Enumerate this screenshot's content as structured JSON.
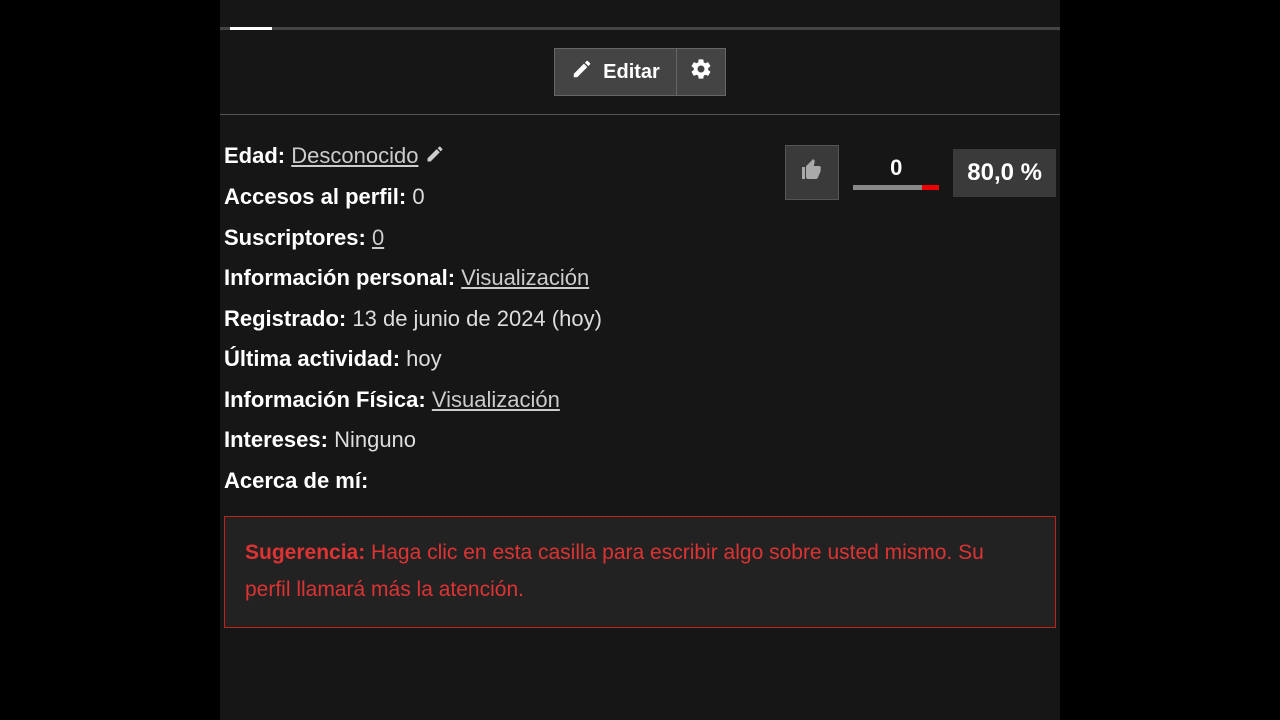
{
  "toolbar": {
    "edit_label": "Editar"
  },
  "info": {
    "age_label": "Edad:",
    "age_value": "Desconocido",
    "views_label": "Accesos al perfil:",
    "views_value": "0",
    "subscribers_label": "Suscriptores:",
    "subscribers_value": "0",
    "personal_label": "Información personal:",
    "personal_link": "Visualización",
    "registered_label": "Registrado:",
    "registered_value": "13 de junio de 2024 (hoy)",
    "activity_label": "Última actividad:",
    "activity_value": "hoy",
    "physical_label": "Información Física:",
    "physical_link": "Visualización",
    "interests_label": "Intereses:",
    "interests_value": "Ninguno",
    "about_label": "Acerca de mí:"
  },
  "stats": {
    "likes_count": "0",
    "percent": "80,0 %"
  },
  "suggestion": {
    "label": "Sugerencia:",
    "text": " Haga clic en esta casilla para escribir algo sobre usted mismo. Su perfil llamará más la atención."
  }
}
